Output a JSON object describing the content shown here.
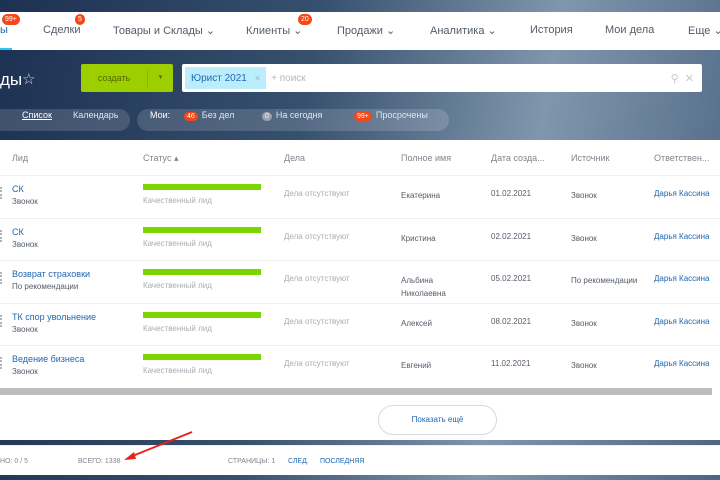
{
  "nav": {
    "items": [
      {
        "label": "ы",
        "badge": "99+"
      },
      {
        "label": "Сделки",
        "badge": "5"
      },
      {
        "label": "Товары и Склады ⌄"
      },
      {
        "label": "Клиенты ⌄",
        "badge": "20"
      },
      {
        "label": "Продажи ⌄"
      },
      {
        "label": "Аналитика ⌄"
      },
      {
        "label": "История"
      },
      {
        "label": "Мои дела"
      },
      {
        "label": "Еще ⌄"
      }
    ]
  },
  "header": {
    "title": "ды",
    "star": "☆",
    "create_label": "создать",
    "create_arrow": "▾",
    "filter_chip": "Юрист 2021",
    "chip_close": "×",
    "search_placeholder": "+ поиск",
    "search_icon": "⚲",
    "clear_icon": "✕"
  },
  "filters": {
    "list": "Список",
    "calendar": "Календарь",
    "mine": "Мои:",
    "no_tasks_count": "46",
    "no_tasks": "Без дел",
    "today_count": "0",
    "today": "На сегодня",
    "overdue_count": "99+",
    "overdue": "Просрочены"
  },
  "table": {
    "headers": [
      "Лид",
      "Статус ▴",
      "Дела",
      "Полное имя",
      "Дата созда...",
      "Источник",
      "Ответствен..."
    ],
    "rows": [
      {
        "lead": "СК",
        "source_sub": "Звонок",
        "status": "Качественный лид",
        "tasks": "Дела отсутствуют",
        "name": "Екатерина",
        "date": "01.02.2021",
        "source": "Звонок",
        "responsible": "Дарья Кассина"
      },
      {
        "lead": "СК",
        "source_sub": "Звонок",
        "status": "Качественный лид",
        "tasks": "Дела отсутствуют",
        "name": "Кристина",
        "date": "02.02.2021",
        "source": "Звонок",
        "responsible": "Дарья Кассина"
      },
      {
        "lead": "Возврат страховки",
        "source_sub": "По рекомендации",
        "status": "Качественный лид",
        "tasks": "Дела отсутствуют",
        "name": "Альбина Николаевна",
        "date": "05.02.2021",
        "source": "По рекомендации",
        "responsible": "Дарья Кассина"
      },
      {
        "lead": "ТК спор увольнение",
        "source_sub": "Звонок",
        "status": "Качественный лид",
        "tasks": "Дела отсутствуют",
        "name": "Алексей",
        "date": "08.02.2021",
        "source": "Звонок",
        "responsible": "Дарья Кассина"
      },
      {
        "lead": "Ведение бизнеса",
        "source_sub": "Звонок",
        "status": "Качественный лид",
        "tasks": "Дела отсутствуют",
        "name": "Евгений",
        "date": "11.02.2021",
        "source": "Звонок",
        "responsible": "Дарья Кассина"
      }
    ],
    "show_more": "Показать ещё"
  },
  "footer": {
    "selected": "НО: 0 / 5",
    "total": "ВСЕГО: 1338",
    "pages": "СТРАНИЦЫ: 1",
    "next": "СЛЕД.",
    "last": "ПОСЛЕДНЯЯ"
  }
}
